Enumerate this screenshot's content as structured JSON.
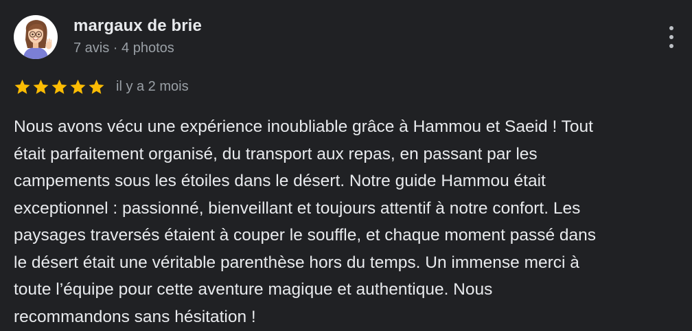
{
  "review": {
    "author": {
      "name": "margaux de brie",
      "meta": "7 avis · 4 photos",
      "avatar_icon": "memoji-avatar-icon"
    },
    "rating": {
      "stars": 5,
      "max": 5,
      "star_color": "#fbbc04",
      "date": "il y a 2 mois"
    },
    "more_icon": "more-vert-icon",
    "text_lines": [
      "Nous avons vécu une expérience inoubliable grâce à Hammou et Saeid ! Tout",
      "était parfaitement organisé, du transport aux repas, en passant par les",
      "campements sous les étoiles dans le désert. Notre guide Hammou était",
      "exceptionnel : passionné, bienveillant et toujours attentif à notre confort. Les",
      "paysages traversés étaient à couper le souffle, et chaque moment passé dans",
      "le désert était une véritable parenthèse hors du temps. Un immense merci à",
      "toute l’équipe pour cette aventure magique et authentique. Nous",
      "recommandons sans hésitation !"
    ]
  },
  "colors": {
    "background": "#202124",
    "primary_text": "#e8eaed",
    "secondary_text": "#9aa0a6"
  }
}
